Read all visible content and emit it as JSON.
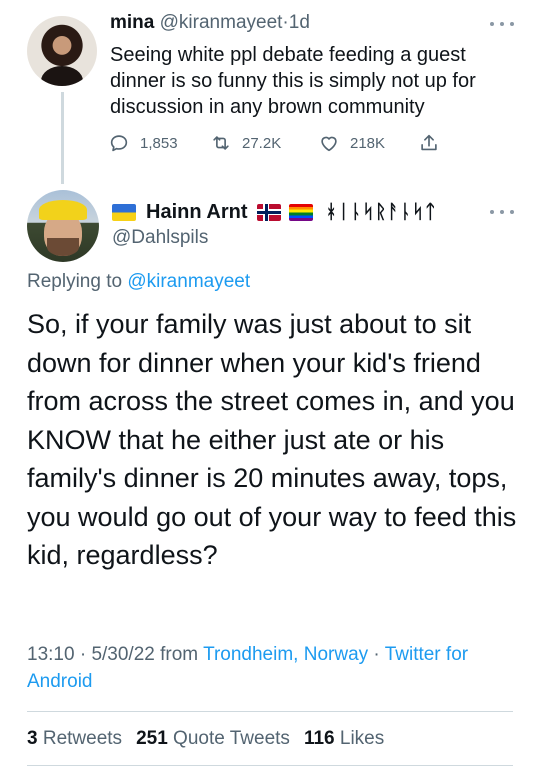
{
  "parent_tweet": {
    "display_name": "mina",
    "handle": "@kiranmayeet",
    "separator": "·",
    "age": "1d",
    "text": "Seeing white ppl debate feeding a guest dinner is so funny this is simply not up for discussion in any brown community",
    "actions": {
      "replies": "1,853",
      "retweets": "27.2K",
      "likes": "218K"
    }
  },
  "main_tweet": {
    "display_name": "Hainn Arnt",
    "runic_name": "ᚼᛁᚿᛋᚱᚨᚿᛋᛏ",
    "handle": "@Dahlspils",
    "replying_label": "Replying to",
    "replying_to": "@kiranmayeet",
    "text": "So, if your family was just about to sit down for dinner when your kid's friend from across the street comes in, and you KNOW that he either just ate or his family's dinner is 20 minutes away, tops, you would go out of your way to feed this kid, regardless?",
    "time": "13:10",
    "sep1": "·",
    "date": "5/30/22",
    "from_label": "from",
    "location": "Trondheim, Norway",
    "sep2": "·",
    "source": "Twitter for Android",
    "stats": {
      "retweets_count": "3",
      "retweets_label": "Retweets",
      "quotes_count": "251",
      "quotes_label": "Quote Tweets",
      "likes_count": "116",
      "likes_label": "Likes"
    }
  },
  "icons": [
    "reply-icon",
    "retweet-icon",
    "like-icon",
    "share-icon",
    "more-icon"
  ],
  "colors": {
    "link": "#1d9bf0",
    "secondary_text": "#536471",
    "primary_text": "#0f1419",
    "divider": "#cfd9de"
  }
}
